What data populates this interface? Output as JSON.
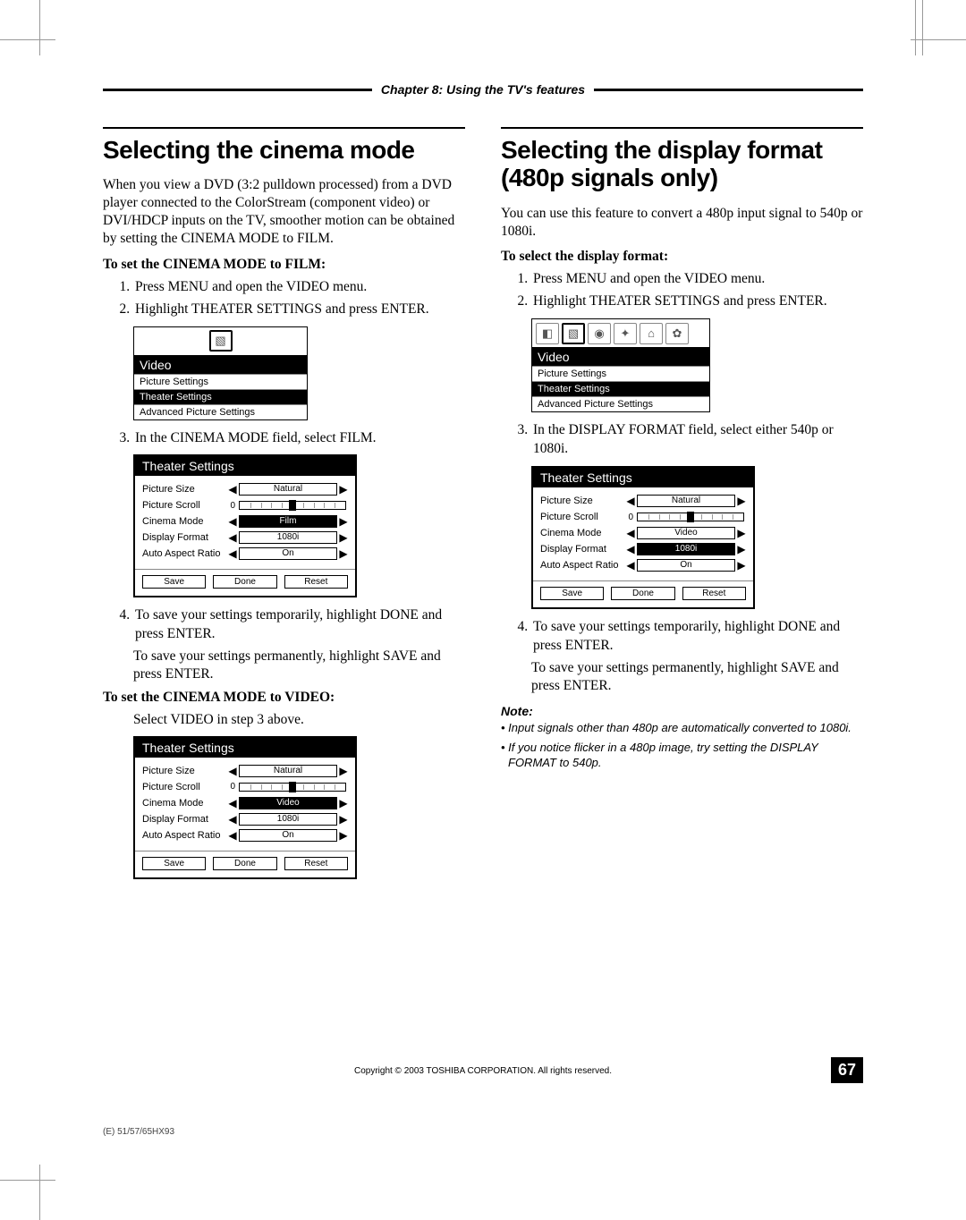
{
  "chapter": "Chapter 8: Using the TV's features",
  "page_number": "67",
  "copyright": "Copyright © 2003 TOSHIBA CORPORATION. All rights reserved.",
  "footnote": "(E) 51/57/65HX93",
  "left": {
    "heading": "Selecting the cinema mode",
    "intro": "When you view a DVD (3:2 pulldown processed) from a DVD player connected to the ColorStream (component video) or DVI/HDCP inputs on the TV, smoother motion can be obtained by setting the CINEMA MODE to FILM.",
    "instr1": "To set the CINEMA MODE to FILM:",
    "steps1": [
      "Press MENU and open the VIDEO menu.",
      "Highlight THEATER SETTINGS and press ENTER."
    ],
    "step3": "In the CINEMA MODE field, select FILM.",
    "step4": "To save your settings temporarily, highlight DONE and press ENTER.",
    "step4b": "To save your settings permanently, highlight SAVE and press ENTER.",
    "instr2": "To set the CINEMA MODE to VIDEO:",
    "instr2_body": "Select VIDEO in step 3 above.",
    "osd_video": {
      "title": "Video",
      "rows": [
        "Picture Settings",
        "Theater Settings",
        "Advanced Picture Settings"
      ],
      "highlight_index": 1
    },
    "osd_theater_film": {
      "title": "Theater Settings",
      "picture_size": "Natural",
      "picture_scroll": "0",
      "cinema_mode": "Film",
      "display_format": "1080i",
      "auto_aspect": "On",
      "hl_field": "cinema_mode",
      "buttons": [
        "Save",
        "Done",
        "Reset"
      ]
    },
    "osd_theater_video": {
      "title": "Theater Settings",
      "picture_size": "Natural",
      "picture_scroll": "0",
      "cinema_mode": "Video",
      "display_format": "1080i",
      "auto_aspect": "On",
      "hl_field": "cinema_mode",
      "buttons": [
        "Save",
        "Done",
        "Reset"
      ]
    },
    "row_labels": {
      "picture_size": "Picture Size",
      "picture_scroll": "Picture Scroll",
      "cinema_mode": "Cinema Mode",
      "display_format": "Display Format",
      "auto_aspect": "Auto Aspect Ratio"
    }
  },
  "right": {
    "heading": "Selecting the display format (480p signals only)",
    "intro": "You can use this feature to convert a 480p input signal to 540p or 1080i.",
    "instr1": "To select the display format:",
    "steps1": [
      "Press MENU and open the VIDEO menu.",
      "Highlight THEATER SETTINGS and press ENTER."
    ],
    "step3": "In the DISPLAY FORMAT field, select either 540p or 1080i.",
    "step4": "To save your settings temporarily, highlight DONE and press ENTER.",
    "step4b": "To save your settings permanently, highlight SAVE and press ENTER.",
    "osd_video": {
      "title": "Video",
      "rows": [
        "Picture Settings",
        "Theater Settings",
        "Advanced Picture Settings"
      ],
      "highlight_index": 1
    },
    "osd_theater": {
      "title": "Theater Settings",
      "picture_size": "Natural",
      "picture_scroll": "0",
      "cinema_mode": "Video",
      "display_format": "1080i",
      "auto_aspect": "On",
      "hl_field": "display_format",
      "buttons": [
        "Save",
        "Done",
        "Reset"
      ]
    },
    "note_label": "Note:",
    "notes": [
      "Input signals other than 480p are automatically converted to 1080i.",
      "If you notice flicker in a 480p image, try setting the DISPLAY FORMAT to 540p."
    ]
  }
}
